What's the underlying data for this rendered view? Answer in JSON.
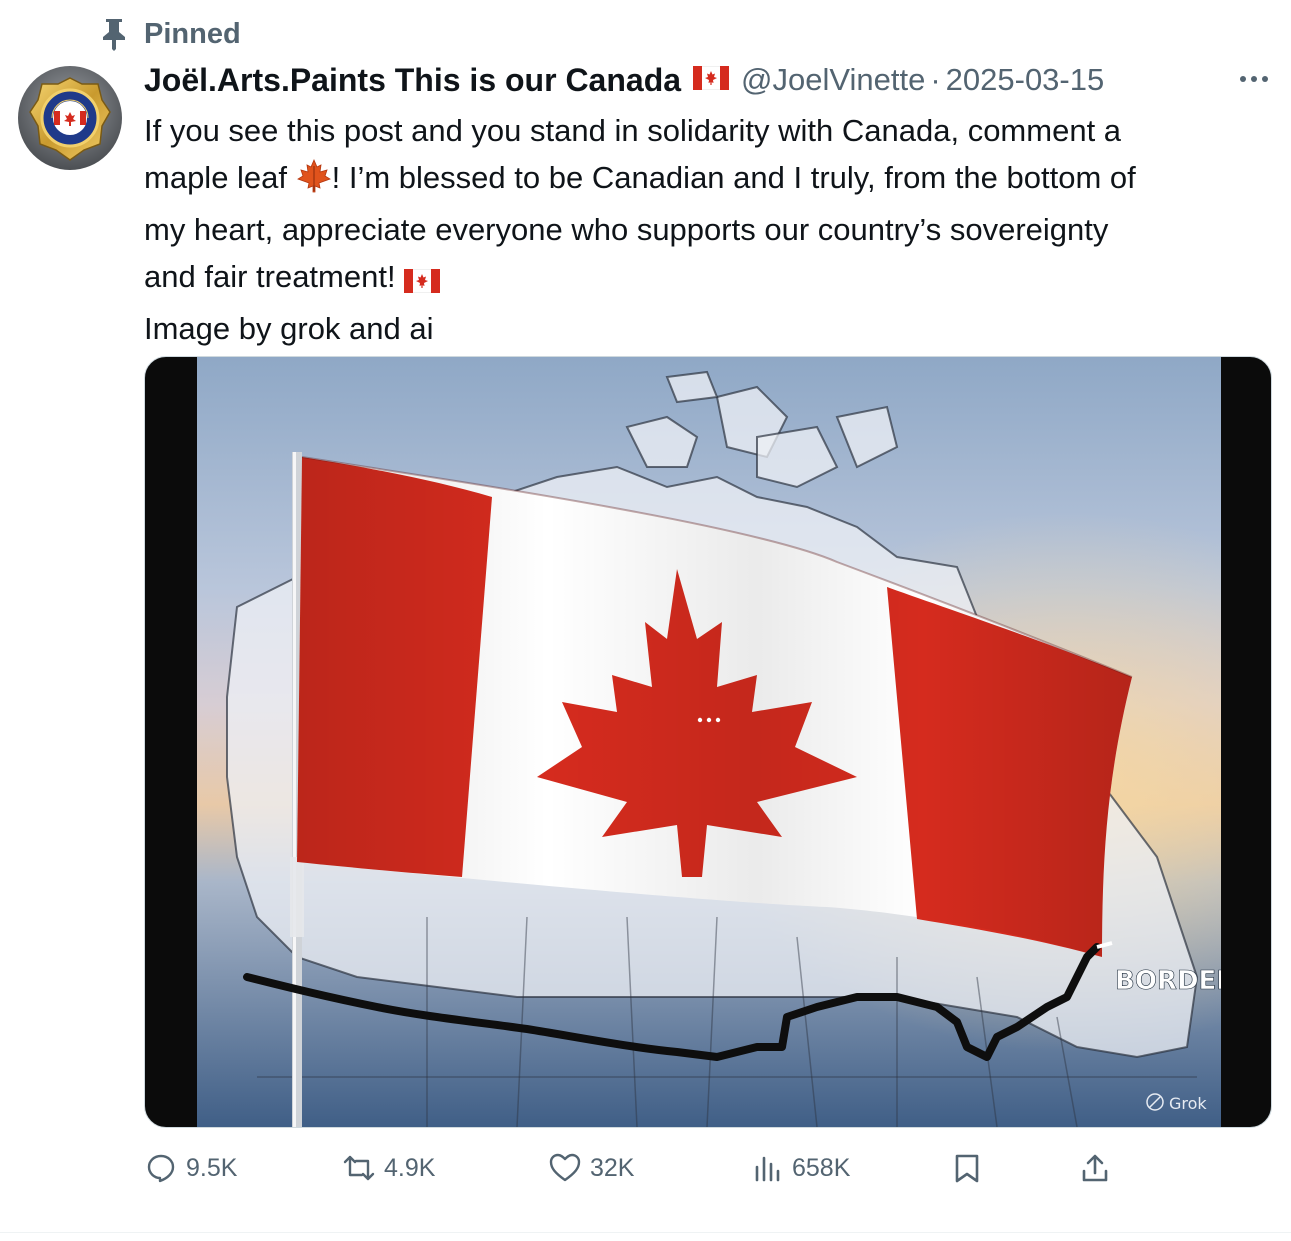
{
  "pinned": {
    "label": "Pinned",
    "icon": "pin-icon"
  },
  "author": {
    "display_name": "Joël.Arts.Paints This is our Canada",
    "handle": "@JoelVinette",
    "separator": "·",
    "date": "2025-03-15",
    "avatar_icon": "canadian-influential-artist-badge"
  },
  "post": {
    "line1": "If you see this post and you stand in solidarity with Canada, comment a",
    "line2_a": "maple leaf ",
    "line2_b": "! I’m blessed to be Canadian and I truly, from the bottom of",
    "line3": "my heart, appreciate everyone who supports our country’s sovereignty",
    "line4": "and fair treatment! ",
    "line5": "Image by grok and ai"
  },
  "media": {
    "overlay_label": "BORDER LINE!",
    "watermark": "Grok"
  },
  "actions": {
    "replies": "9.5K",
    "reposts": "4.9K",
    "likes": "32K",
    "views": "658K"
  },
  "colors": {
    "text_primary": "#0f1419",
    "text_secondary": "#536471",
    "flag_red": "#d52b1e"
  }
}
